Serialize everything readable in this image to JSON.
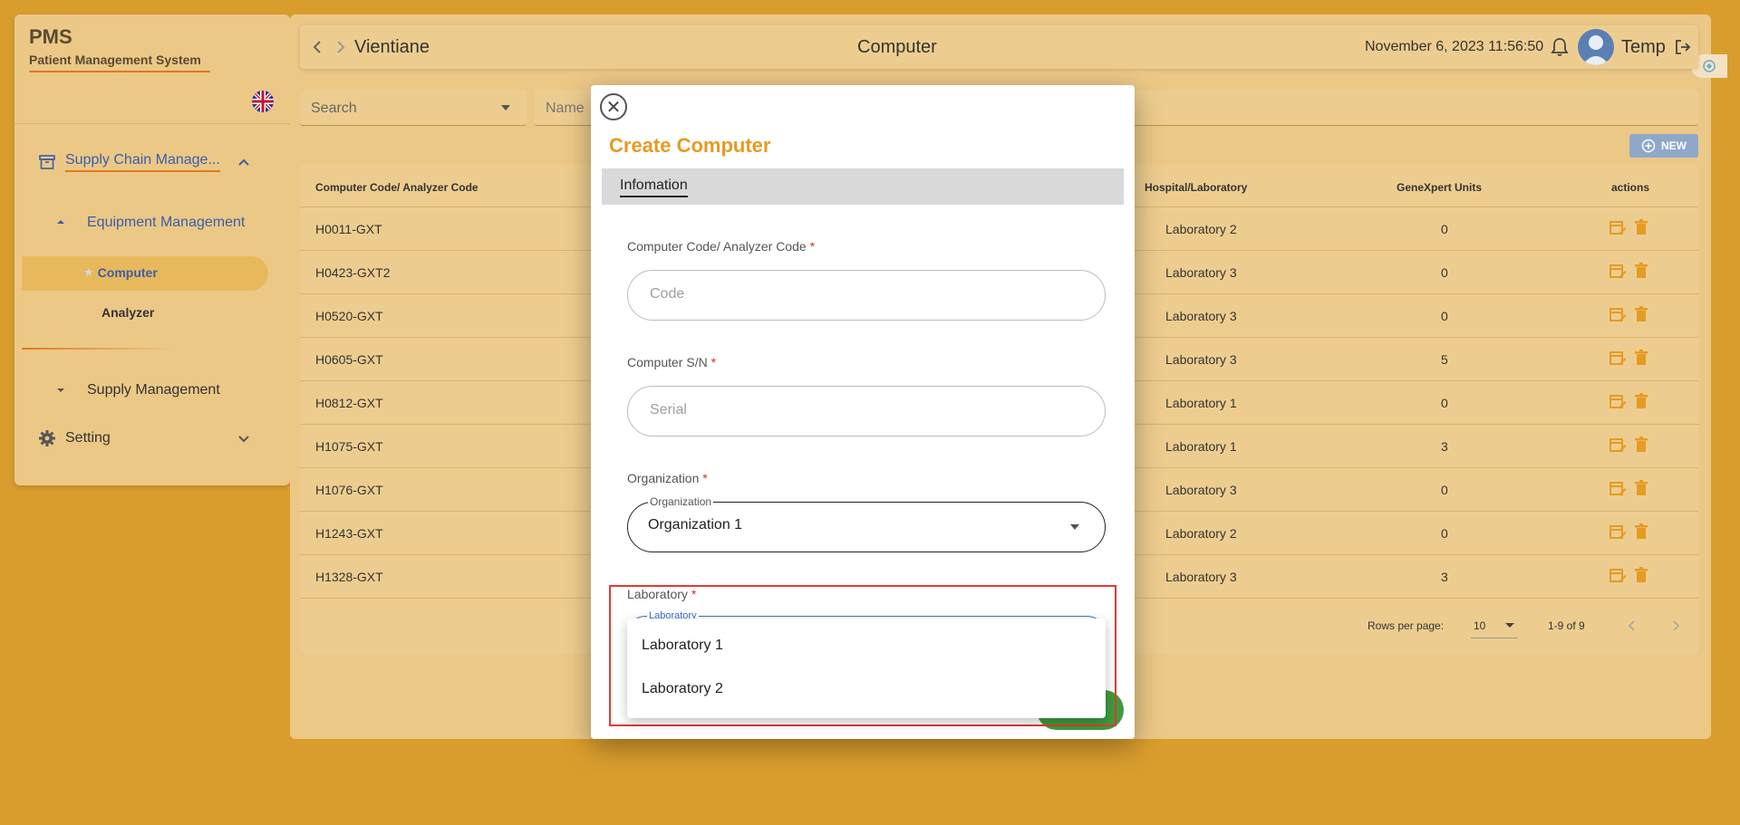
{
  "app": {
    "logo_title": "PMS",
    "logo_subtitle": "Patient Management System"
  },
  "sidebar": {
    "group": "Supply Chain Manage...",
    "sub_group": "Equipment Management",
    "items": [
      {
        "label": "Computer"
      },
      {
        "label": "Analyzer"
      }
    ],
    "supply": "Supply Management",
    "setting": "Setting"
  },
  "topbar": {
    "location": "Vientiane",
    "page_title": "Computer",
    "datetime": "November 6, 2023 11:56:50",
    "user": "Temp"
  },
  "filters": {
    "search": "Search",
    "name": "Name"
  },
  "toolbar": {
    "new_label": "NEW"
  },
  "table": {
    "headers": [
      "Computer Code/ Analyzer Code",
      "Hospital/Laboratory",
      "GeneXpert Units",
      "actions"
    ],
    "rows": [
      {
        "code": "H0011-GXT",
        "lab": "Laboratory 2",
        "units": "0"
      },
      {
        "code": "H0423-GXT2",
        "lab": "Laboratory 3",
        "units": "0"
      },
      {
        "code": "H0520-GXT",
        "lab": "Laboratory 3",
        "units": "0"
      },
      {
        "code": "H0605-GXT",
        "lab": "Laboratory 3",
        "units": "5"
      },
      {
        "code": "H0812-GXT",
        "lab": "Laboratory 1",
        "units": "0"
      },
      {
        "code": "H1075-GXT",
        "lab": "Laboratory 1",
        "units": "3"
      },
      {
        "code": "H1076-GXT",
        "lab": "Laboratory 3",
        "units": "0"
      },
      {
        "code": "H1243-GXT",
        "lab": "Laboratory 2",
        "units": "0"
      },
      {
        "code": "H1328-GXT",
        "lab": "Laboratory 3",
        "units": "3"
      }
    ],
    "rows_per_page_label": "Rows per page:",
    "rows_per_page": "10",
    "range": "1-9 of 9"
  },
  "dialog": {
    "title": "Create Computer",
    "tab": "Infomation",
    "code_label": "Computer Code/ Analyzer Code",
    "code_placeholder": "Code",
    "serial_label": "Computer S/N",
    "serial_placeholder": "Serial",
    "org_label": "Organization",
    "org_legend": "Organization",
    "org_value": "Organization 1",
    "lab_label": "Laboratory",
    "lab_legend": "Laboratory",
    "lab_options": [
      "Laboratory 1",
      "Laboratory 2"
    ],
    "required_mark": "*"
  },
  "colors": {
    "accent": "#e69b22",
    "link": "#3b5ea8",
    "background": "#d99d2d",
    "highlight": "#e53935",
    "save": "#3d9b3d"
  }
}
